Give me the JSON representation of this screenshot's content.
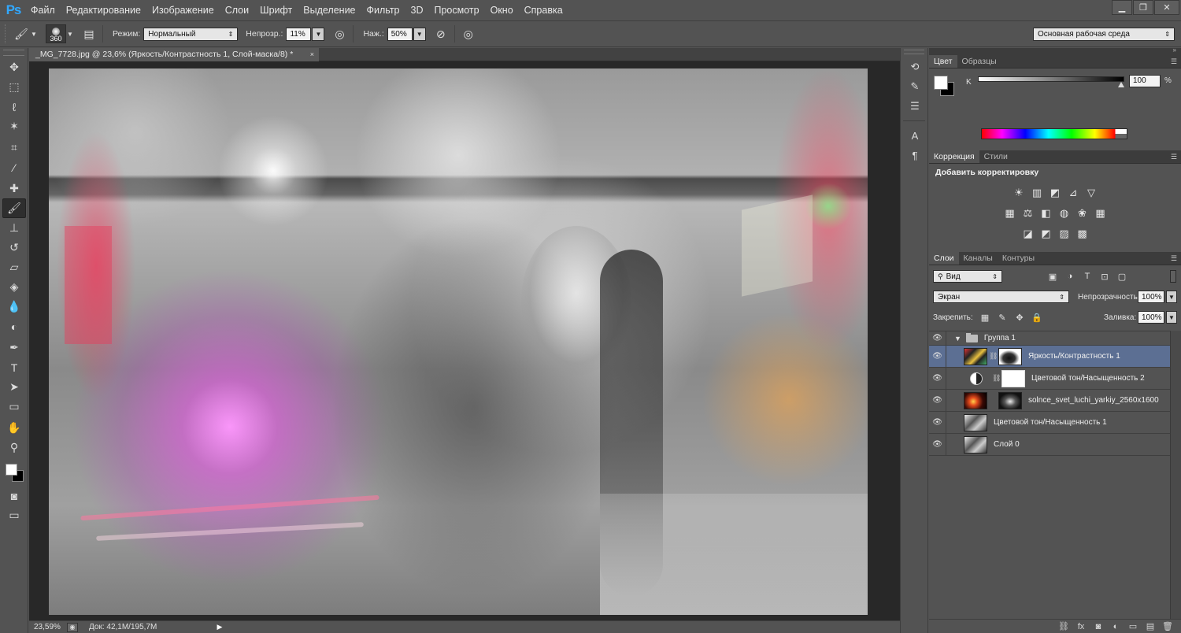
{
  "app": {
    "logo": "Ps"
  },
  "menu": [
    "Файл",
    "Редактирование",
    "Изображение",
    "Слои",
    "Шрифт",
    "Выделение",
    "Фильтр",
    "3D",
    "Просмотр",
    "Окно",
    "Справка"
  ],
  "window_controls": {
    "minimize": "▁",
    "restore": "❐",
    "close": "✕"
  },
  "options_bar": {
    "brush_size": "360",
    "mode_label": "Режим:",
    "mode_value": "Нормальный",
    "opacity_label": "Непрозр.:",
    "opacity_value": "11%",
    "flow_label": "Наж.:",
    "flow_value": "50%",
    "workspace": "Основная рабочая среда"
  },
  "document": {
    "tab_title": "_MG_7728.jpg @ 23,6% (Яркость/Контрастность 1, Слой-маска/8) *",
    "close_glyph": "×"
  },
  "status_bar": {
    "zoom": "23,59%",
    "doc_size": "Док: 42,1M/195,7M",
    "arrow": "▶"
  },
  "tools": [
    {
      "name": "move-tool",
      "glyph": "✥"
    },
    {
      "name": "marquee-tool",
      "glyph": "⬚"
    },
    {
      "name": "lasso-tool",
      "glyph": "ℓ"
    },
    {
      "name": "magic-wand-tool",
      "glyph": "✶"
    },
    {
      "name": "crop-tool",
      "glyph": "⌗"
    },
    {
      "name": "eyedropper-tool",
      "glyph": "⁄"
    },
    {
      "name": "healing-brush-tool",
      "glyph": "✚"
    },
    {
      "name": "brush-tool",
      "glyph": "🖌",
      "active": true
    },
    {
      "name": "clone-stamp-tool",
      "glyph": "⊥"
    },
    {
      "name": "history-brush-tool",
      "glyph": "↺"
    },
    {
      "name": "eraser-tool",
      "glyph": "▱"
    },
    {
      "name": "paint-bucket-tool",
      "glyph": "◈"
    },
    {
      "name": "blur-tool",
      "glyph": "💧"
    },
    {
      "name": "dodge-tool",
      "glyph": "◐"
    },
    {
      "name": "pen-tool",
      "glyph": "✒"
    },
    {
      "name": "type-tool",
      "glyph": "T"
    },
    {
      "name": "path-selection-tool",
      "glyph": "➤"
    },
    {
      "name": "rectangle-tool",
      "glyph": "▭"
    },
    {
      "name": "hand-tool",
      "glyph": "✋"
    },
    {
      "name": "zoom-tool",
      "glyph": "⚲"
    }
  ],
  "colors": {
    "foreground": "#ffffff",
    "background": "#000000"
  },
  "strip_buttons": [
    {
      "name": "history-panel-button",
      "glyph": "⟲"
    },
    {
      "name": "brush-preset-panel-button",
      "glyph": "✎"
    },
    {
      "name": "brush-panel-button",
      "glyph": "☰"
    },
    {
      "name": "character-panel-button",
      "glyph": "A"
    },
    {
      "name": "paragraph-panel-button",
      "glyph": "¶"
    }
  ],
  "color_panel": {
    "tabs": [
      "Цвет",
      "Образцы"
    ],
    "channel_label": "K",
    "value": "100",
    "percent": "%",
    "k_level": 0.98
  },
  "adjustments_panel": {
    "tabs": [
      "Коррекция",
      "Стили"
    ],
    "title": "Добавить корректировку",
    "rows": [
      [
        "☀",
        "▥",
        "◩",
        "⊿",
        "▽"
      ],
      [
        "▦",
        "⚖",
        "◧",
        "◍",
        "❀",
        "▦"
      ],
      [
        "◪",
        "◩",
        "▨",
        "▩"
      ]
    ]
  },
  "layers_panel": {
    "tabs": [
      "Слои",
      "Каналы",
      "Контуры"
    ],
    "filter_value": "Вид",
    "filter_icons": [
      "▣",
      "◑",
      "T",
      "⊡",
      "▢"
    ],
    "blend_mode": "Экран",
    "opacity_label": "Непрозрачность:",
    "opacity_value": "100%",
    "lock_label": "Закрепить:",
    "lock_icons": [
      "▦",
      "✎",
      "✥",
      "🔒"
    ],
    "fill_label": "Заливка:",
    "fill_value": "100%",
    "layers": [
      {
        "name": "Группа 1",
        "type": "group"
      },
      {
        "name": "Яркость/Контрастность 1",
        "type": "adjustment",
        "selected": true
      },
      {
        "name": "Цветовой тон/Насыщенность 2",
        "type": "adjustment-plain"
      },
      {
        "name": "solnce_svet_luchi_yarkiy_2560x1600",
        "type": "image-masked"
      },
      {
        "name": "Цветовой тон/Насыщенность 1",
        "type": "image"
      },
      {
        "name": "Слой 0",
        "type": "base"
      }
    ],
    "footer_icons": [
      "⛓",
      "fx",
      "◙",
      "◐",
      "▭",
      "▤",
      "🗑"
    ]
  }
}
